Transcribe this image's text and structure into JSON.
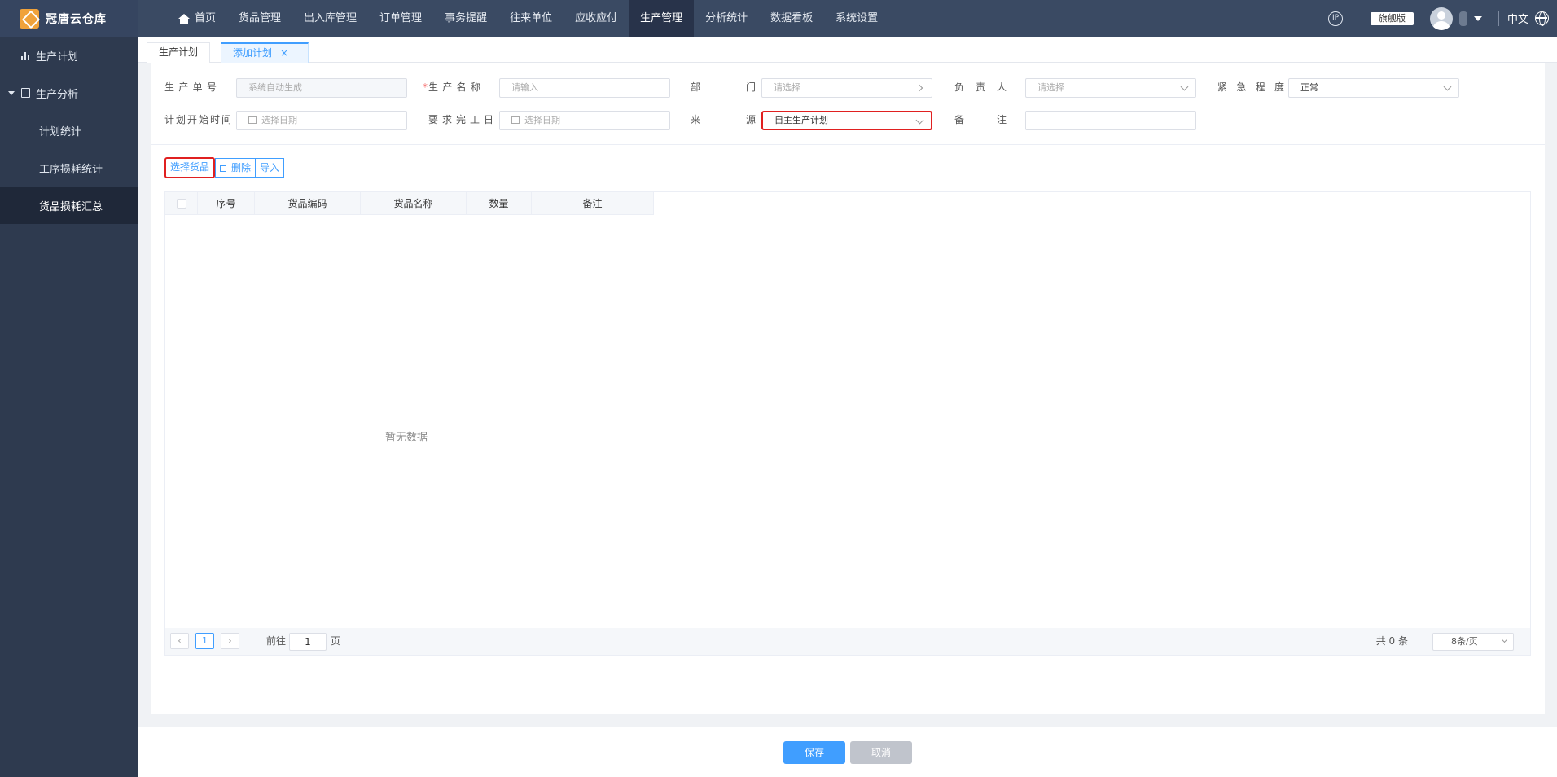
{
  "app": {
    "name": "冠唐云仓库"
  },
  "nav": [
    {
      "label": "首页",
      "icon": "home-icon"
    },
    {
      "label": "货品管理"
    },
    {
      "label": "出入库管理"
    },
    {
      "label": "订单管理"
    },
    {
      "label": "事务提醒"
    },
    {
      "label": "往来单位"
    },
    {
      "label": "应收应付"
    },
    {
      "label": "生产管理",
      "active": true
    },
    {
      "label": "分析统计"
    },
    {
      "label": "数据看板"
    },
    {
      "label": "系统设置"
    }
  ],
  "topbar": {
    "edition": "旗舰版",
    "language": "中文",
    "circle_icon_text": "IP"
  },
  "sidebar": {
    "items": [
      {
        "label": "生产计划",
        "icon": "bar-chart-icon"
      },
      {
        "label": "生产分析",
        "icon": "document-icon",
        "expanded": true
      },
      {
        "label": "计划统计"
      },
      {
        "label": "工序损耗统计"
      },
      {
        "label": "货品损耗汇总",
        "active": true
      }
    ]
  },
  "tabs": [
    {
      "label": "生产计划"
    },
    {
      "label": "添加计划",
      "active": true,
      "close": "×"
    }
  ],
  "form": {
    "production_no": {
      "label": "生产单号",
      "placeholder": "系统自动生成"
    },
    "production_name": {
      "required_mark": "*",
      "label": "生产名称",
      "placeholder": "请输入"
    },
    "department": {
      "label": "部门",
      "placeholder": "请选择"
    },
    "owner": {
      "label": "负责人",
      "placeholder": "请选择"
    },
    "urgency": {
      "label": "紧急程度",
      "value": "正常"
    },
    "plan_start": {
      "label": "计划开始时间",
      "placeholder": "选择日期"
    },
    "required_finish": {
      "label": "要求完工日",
      "placeholder": "选择日期"
    },
    "source": {
      "label": "来源",
      "value": "自主生产计划"
    },
    "remark": {
      "label": "备注",
      "value": ""
    }
  },
  "toolbar": {
    "select_goods": "选择货品",
    "delete": "删除",
    "import": "导入"
  },
  "table": {
    "columns": [
      "序号",
      "货品编码",
      "货品名称",
      "数量",
      "备注"
    ],
    "rows": [],
    "empty_text": "暂无数据"
  },
  "pagination": {
    "current_page": "1",
    "goto_prefix": "前往",
    "goto_value": "1",
    "goto_suffix": "页",
    "total_text": "共 0 条",
    "page_size": "8条/页"
  },
  "footer": {
    "save": "保存",
    "cancel": "取消"
  },
  "colors": {
    "primary": "#409eff",
    "nav_bg": "#3a4a63",
    "sidebar_bg": "#2e3a4f",
    "highlight_border": "#e02020"
  }
}
